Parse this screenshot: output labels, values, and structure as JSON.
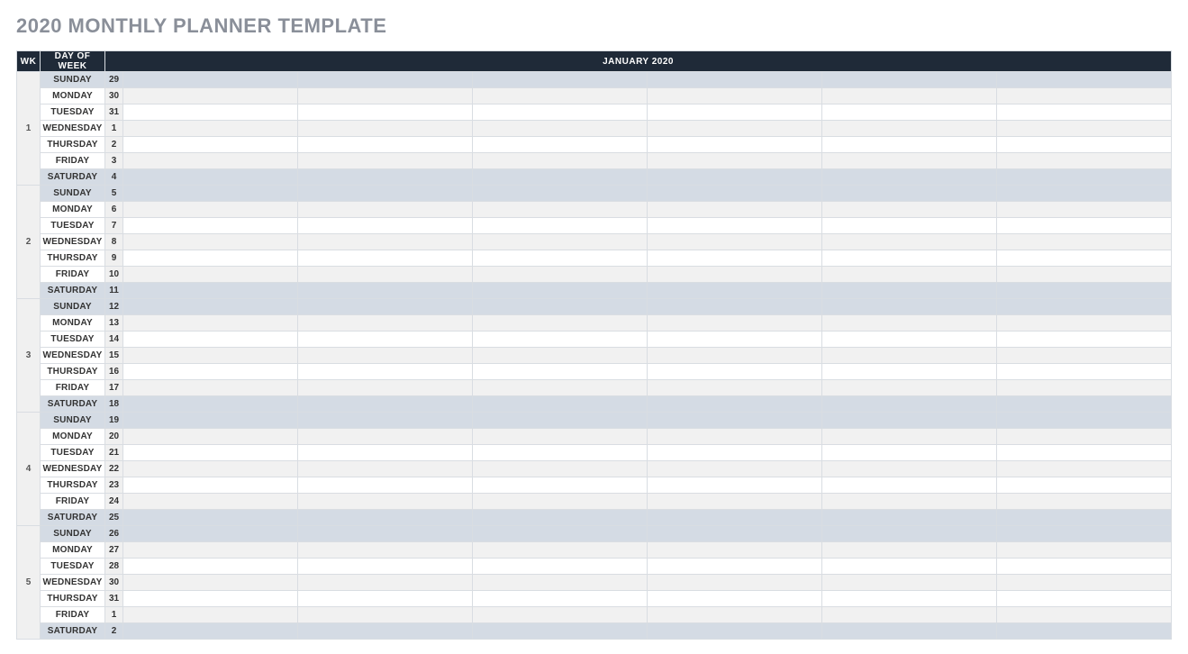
{
  "title": "2020 MONTHLY PLANNER TEMPLATE",
  "header": {
    "wk": "WK",
    "dow": "DAY OF WEEK",
    "month": "JANUARY 2020"
  },
  "slot_columns": 6,
  "weeks": [
    {
      "wk": "1",
      "days": [
        {
          "dow": "SUNDAY",
          "date": "29",
          "weekend": true
        },
        {
          "dow": "MONDAY",
          "date": "30",
          "weekend": false
        },
        {
          "dow": "TUESDAY",
          "date": "31",
          "weekend": false
        },
        {
          "dow": "WEDNESDAY",
          "date": "1",
          "weekend": false
        },
        {
          "dow": "THURSDAY",
          "date": "2",
          "weekend": false
        },
        {
          "dow": "FRIDAY",
          "date": "3",
          "weekend": false
        },
        {
          "dow": "SATURDAY",
          "date": "4",
          "weekend": true
        }
      ]
    },
    {
      "wk": "2",
      "days": [
        {
          "dow": "SUNDAY",
          "date": "5",
          "weekend": true
        },
        {
          "dow": "MONDAY",
          "date": "6",
          "weekend": false
        },
        {
          "dow": "TUESDAY",
          "date": "7",
          "weekend": false
        },
        {
          "dow": "WEDNESDAY",
          "date": "8",
          "weekend": false
        },
        {
          "dow": "THURSDAY",
          "date": "9",
          "weekend": false
        },
        {
          "dow": "FRIDAY",
          "date": "10",
          "weekend": false
        },
        {
          "dow": "SATURDAY",
          "date": "11",
          "weekend": true
        }
      ]
    },
    {
      "wk": "3",
      "days": [
        {
          "dow": "SUNDAY",
          "date": "12",
          "weekend": true
        },
        {
          "dow": "MONDAY",
          "date": "13",
          "weekend": false
        },
        {
          "dow": "TUESDAY",
          "date": "14",
          "weekend": false
        },
        {
          "dow": "WEDNESDAY",
          "date": "15",
          "weekend": false
        },
        {
          "dow": "THURSDAY",
          "date": "16",
          "weekend": false
        },
        {
          "dow": "FRIDAY",
          "date": "17",
          "weekend": false
        },
        {
          "dow": "SATURDAY",
          "date": "18",
          "weekend": true
        }
      ]
    },
    {
      "wk": "4",
      "days": [
        {
          "dow": "SUNDAY",
          "date": "19",
          "weekend": true
        },
        {
          "dow": "MONDAY",
          "date": "20",
          "weekend": false
        },
        {
          "dow": "TUESDAY",
          "date": "21",
          "weekend": false
        },
        {
          "dow": "WEDNESDAY",
          "date": "22",
          "weekend": false
        },
        {
          "dow": "THURSDAY",
          "date": "23",
          "weekend": false
        },
        {
          "dow": "FRIDAY",
          "date": "24",
          "weekend": false
        },
        {
          "dow": "SATURDAY",
          "date": "25",
          "weekend": true
        }
      ]
    },
    {
      "wk": "5",
      "days": [
        {
          "dow": "SUNDAY",
          "date": "26",
          "weekend": true
        },
        {
          "dow": "MONDAY",
          "date": "27",
          "weekend": false
        },
        {
          "dow": "TUESDAY",
          "date": "28",
          "weekend": false
        },
        {
          "dow": "WEDNESDAY",
          "date": "30",
          "weekend": false
        },
        {
          "dow": "THURSDAY",
          "date": "31",
          "weekend": false
        },
        {
          "dow": "FRIDAY",
          "date": "1",
          "weekend": false
        },
        {
          "dow": "SATURDAY",
          "date": "2",
          "weekend": true
        }
      ]
    }
  ]
}
